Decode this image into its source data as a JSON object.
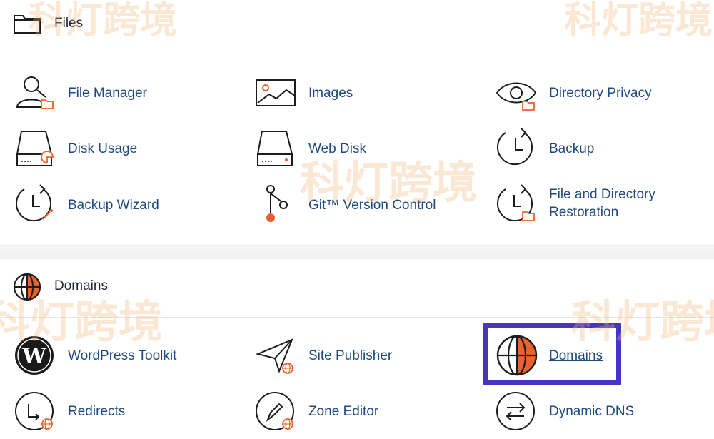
{
  "watermark": "科灯跨境",
  "sections": {
    "files": {
      "title": "Files",
      "tools": {
        "file_manager": "File Manager",
        "images": "Images",
        "directory_privacy": "Directory Privacy",
        "disk_usage": "Disk Usage",
        "web_disk": "Web Disk",
        "backup": "Backup",
        "backup_wizard": "Backup Wizard",
        "git_version_control": "Git™ Version Control",
        "file_dir_restoration": "File and Directory Restoration"
      }
    },
    "domains": {
      "title": "Domains",
      "tools": {
        "wordpress_toolkit": "WordPress Toolkit",
        "site_publisher": "Site Publisher",
        "domains": "Domains",
        "redirects": "Redirects",
        "zone_editor": "Zone Editor",
        "dynamic_dns": "Dynamic DNS"
      }
    }
  },
  "colors": {
    "label": "#1f4a7d",
    "accent": "#e8622f",
    "highlight": "#4535c1",
    "icon_stroke": "#1c1c1c"
  },
  "icons": {
    "files_header": "folder-icon",
    "domains_header": "globe-icon"
  }
}
